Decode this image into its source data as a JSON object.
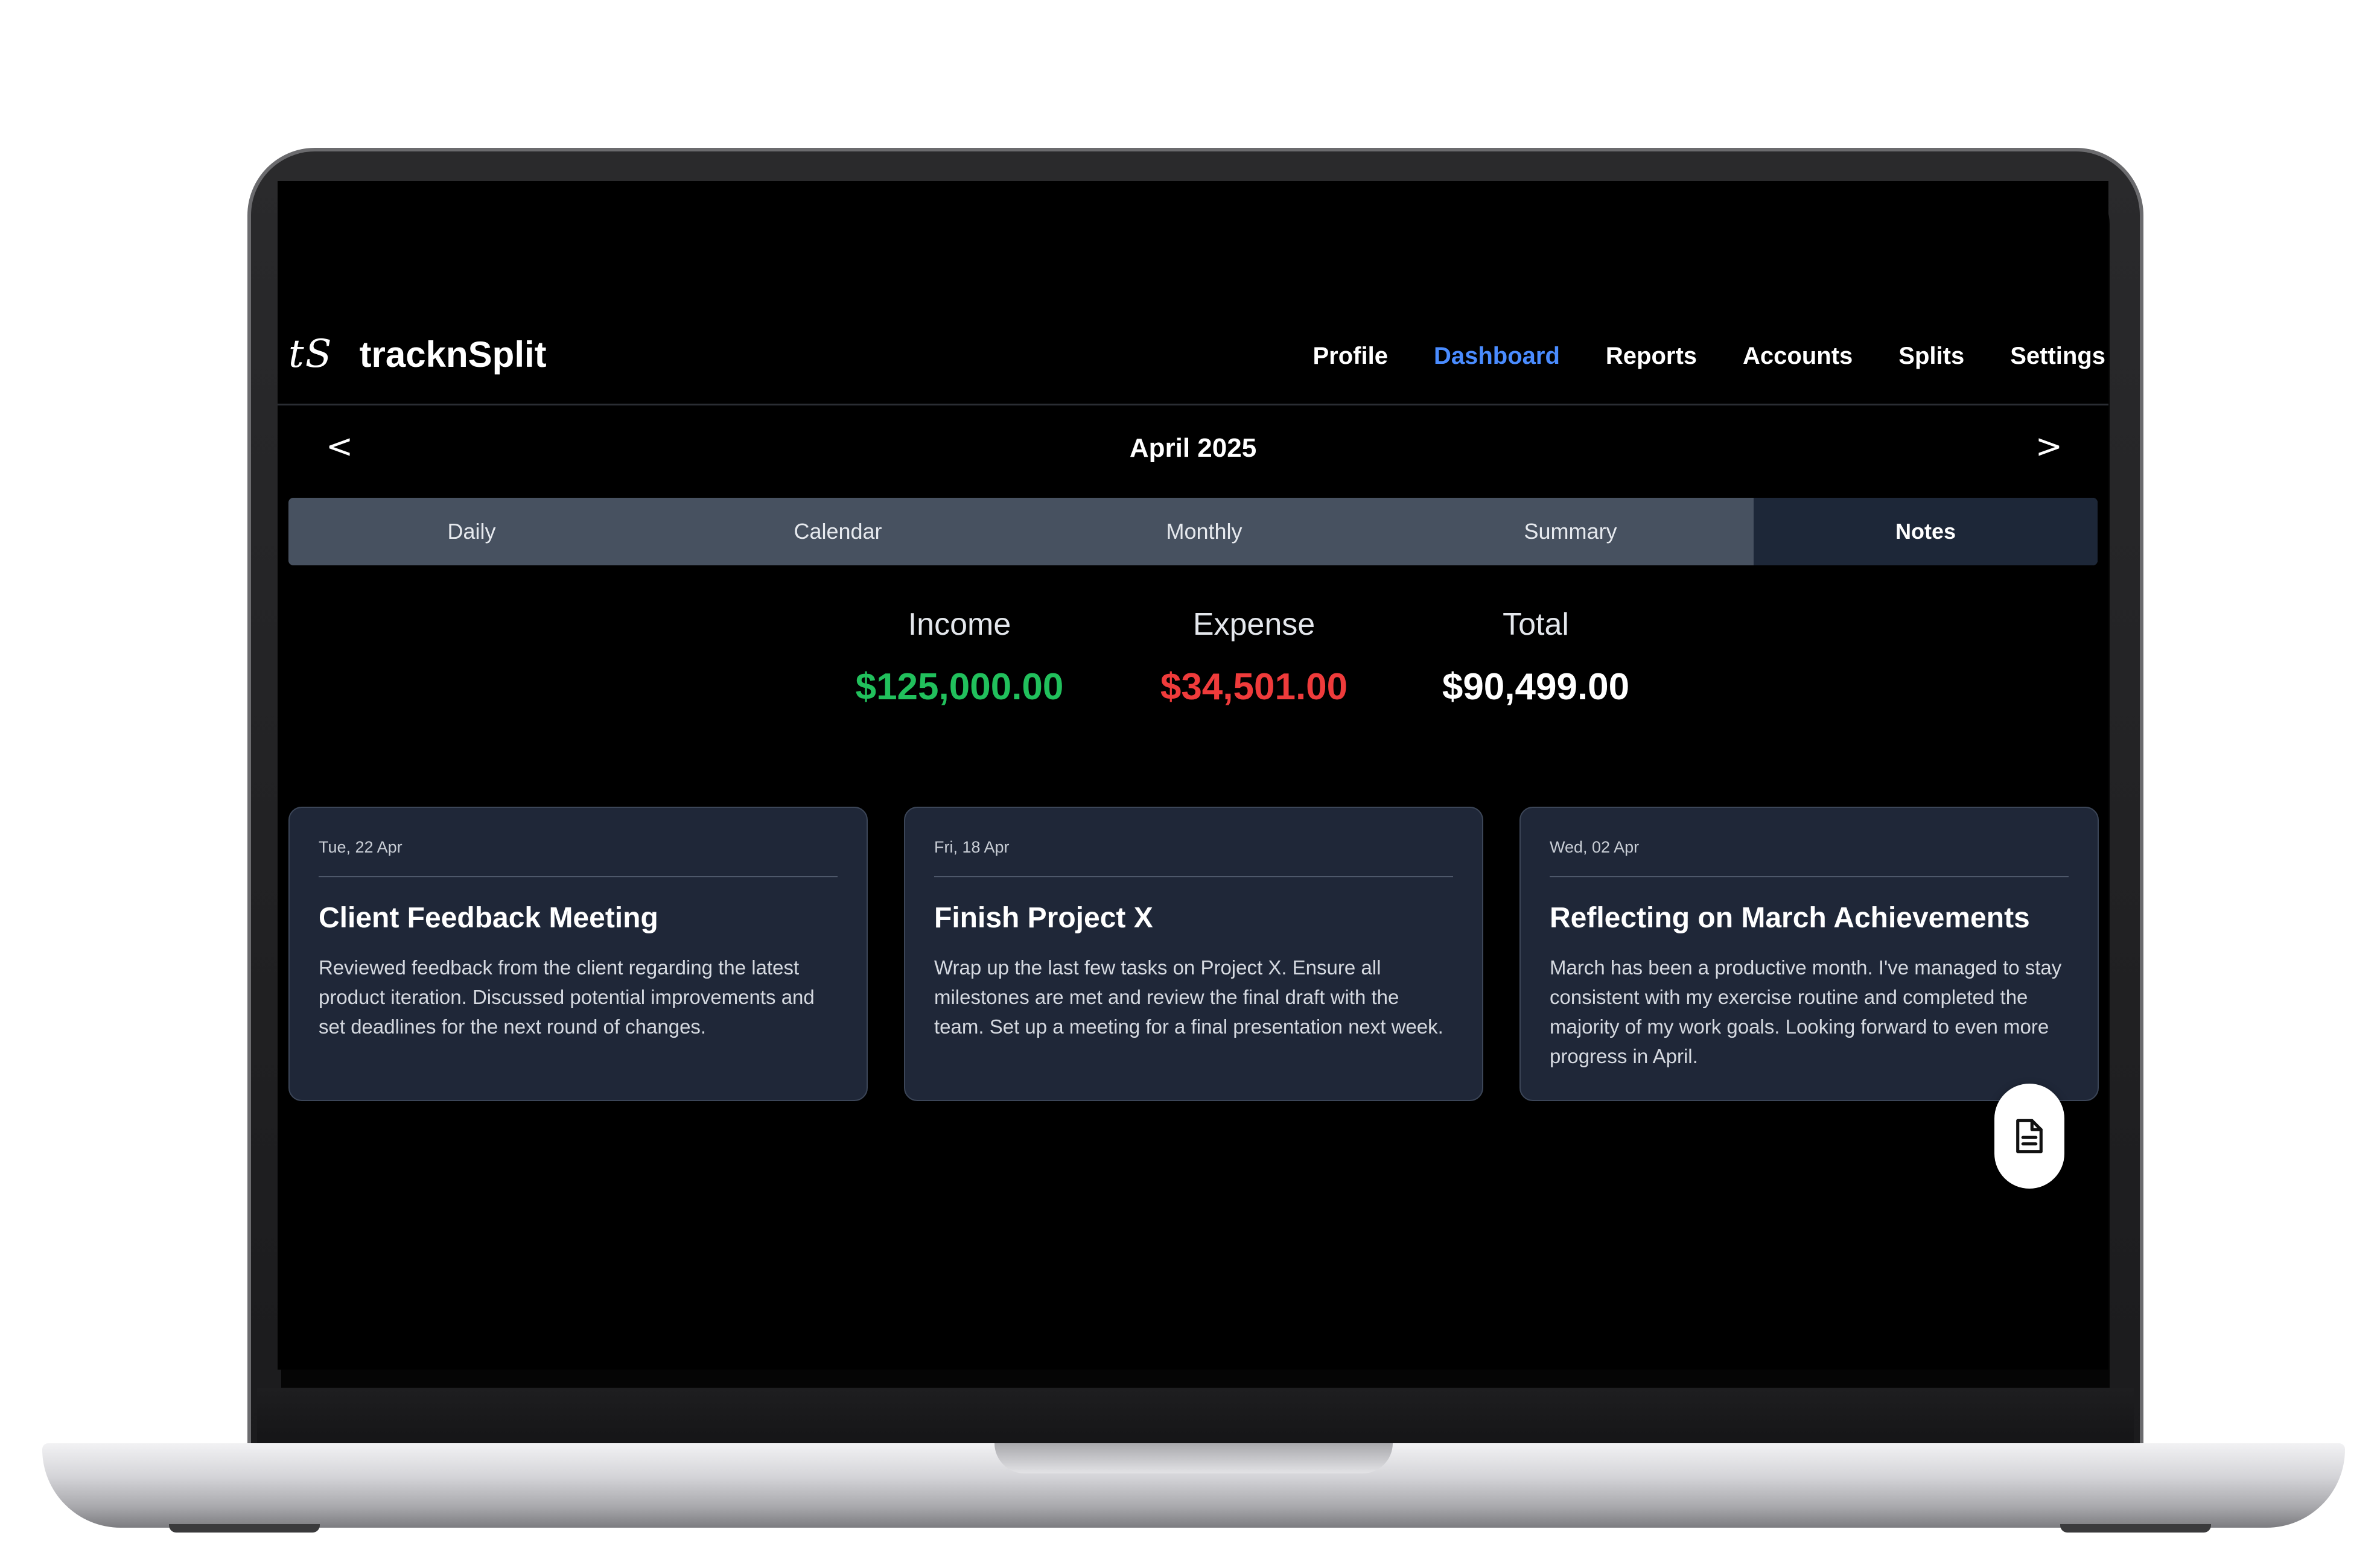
{
  "brand": {
    "logo": "tS",
    "name": "tracknSplit"
  },
  "nav": {
    "items": [
      {
        "label": "Profile",
        "active": false
      },
      {
        "label": "Dashboard",
        "active": true
      },
      {
        "label": "Reports",
        "active": false
      },
      {
        "label": "Accounts",
        "active": false
      },
      {
        "label": "Splits",
        "active": false
      },
      {
        "label": "Settings",
        "active": false
      }
    ],
    "active_color": "#4a8cff"
  },
  "month": {
    "prev": "<",
    "title": "April 2025",
    "next": ">"
  },
  "tabs": [
    {
      "label": "Daily",
      "active": false
    },
    {
      "label": "Calendar",
      "active": false
    },
    {
      "label": "Monthly",
      "active": false
    },
    {
      "label": "Summary",
      "active": false
    },
    {
      "label": "Notes",
      "active": true
    }
  ],
  "summary": {
    "income": {
      "label": "Income",
      "value": "$125,000.00",
      "color": "#21c05c"
    },
    "expense": {
      "label": "Expense",
      "value": "$34,501.00",
      "color": "#ef3b3b"
    },
    "total": {
      "label": "Total",
      "value": "$90,499.00",
      "color": "#ffffff"
    }
  },
  "notes": [
    {
      "date": "Tue, 22 Apr",
      "title": "Client Feedback Meeting",
      "body": "Reviewed feedback from the client regarding the latest product iteration. Discussed potential improvements and set deadlines for the next round of changes."
    },
    {
      "date": "Fri, 18 Apr",
      "title": "Finish Project X",
      "body": "Wrap up the last few tasks on Project X. Ensure all milestones are met and review the final draft with the team. Set up a meeting for a final presentation next week."
    },
    {
      "date": "Wed, 02 Apr",
      "title": "Reflecting on March Achievements",
      "body": "March has been a productive month. I've managed to stay consistent with my exercise routine and completed the majority of my work goals. Looking forward to even more progress in April."
    }
  ],
  "fab": {
    "icon": "document-icon"
  }
}
